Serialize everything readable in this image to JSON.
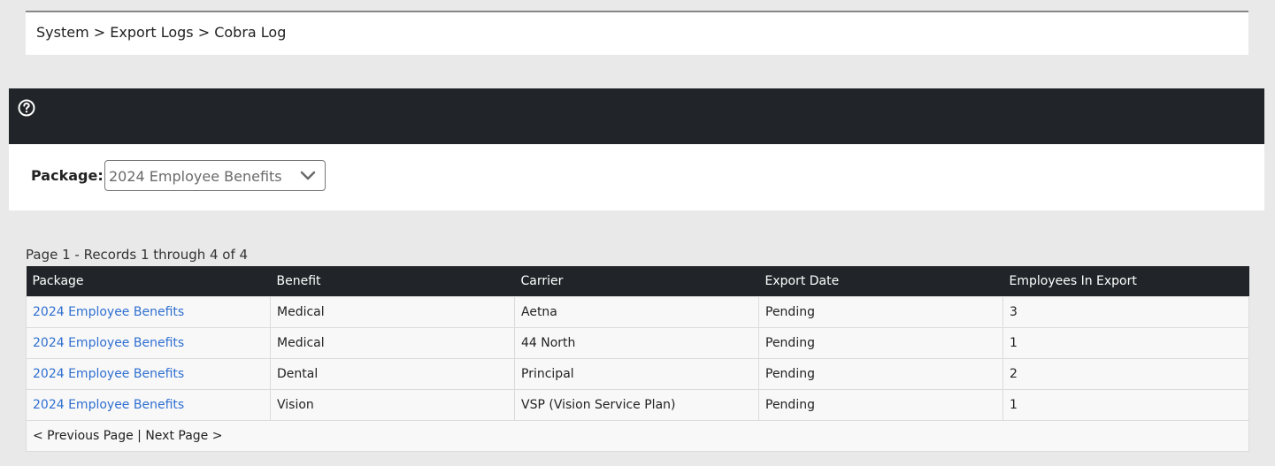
{
  "breadcrumb": "System > Export Logs > Cobra Log",
  "icons": {
    "help": "help-circle-icon",
    "dropdown": "chevron-down-icon"
  },
  "filter": {
    "label": "Package:",
    "selected": "2024 Employee Benefits"
  },
  "records_info": "Page 1 - Records 1 through 4 of 4",
  "table": {
    "headers": [
      "Package",
      "Benefit",
      "Carrier",
      "Export Date",
      "Employees In Export"
    ],
    "rows": [
      [
        "2024 Employee Benefits",
        "Medical",
        "Aetna",
        "Pending",
        "3"
      ],
      [
        "2024 Employee Benefits",
        "Medical",
        "44 North",
        "Pending",
        "1"
      ],
      [
        "2024 Employee Benefits",
        "Dental",
        "Principal",
        "Pending",
        "2"
      ],
      [
        "2024 Employee Benefits",
        "Vision",
        "VSP (Vision Service Plan)",
        "Pending",
        "1"
      ]
    ]
  },
  "pager": {
    "previous": "< Previous Page",
    "separator": " | ",
    "next": "Next Page >"
  },
  "colors": {
    "dark": "#212529",
    "link": "#2f6fd1",
    "background": "#e9e9e9"
  }
}
